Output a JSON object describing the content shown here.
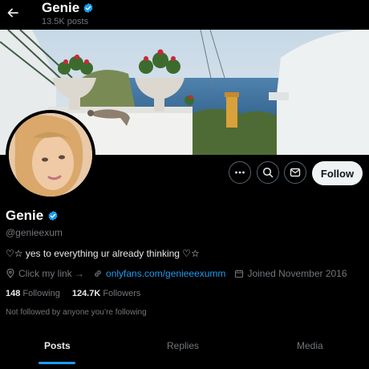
{
  "header": {
    "name": "Genie",
    "posts_count": "13.5K posts"
  },
  "actions": {
    "follow_label": "Follow",
    "more_icon": "more-icon",
    "search_icon": "search-icon",
    "message_icon": "message-icon"
  },
  "profile": {
    "name": "Genie",
    "handle": "@genieexum",
    "bio": "♡☆ yes to everything ur already thinking ♡☆",
    "link_prompt": "Click my link →",
    "website": "onlyfans.com/genieeexumm",
    "joined": "Joined November 2016",
    "following_count": "148",
    "following_label": "Following",
    "followers_count": "124.7K",
    "followers_label": "Followers",
    "follow_context": "Not followed by anyone you’re following"
  },
  "tabs": [
    "Posts",
    "Replies",
    "Media"
  ],
  "colors": {
    "accent": "#1d9bf0",
    "verified": "#1d9bf0",
    "background": "#000000"
  }
}
